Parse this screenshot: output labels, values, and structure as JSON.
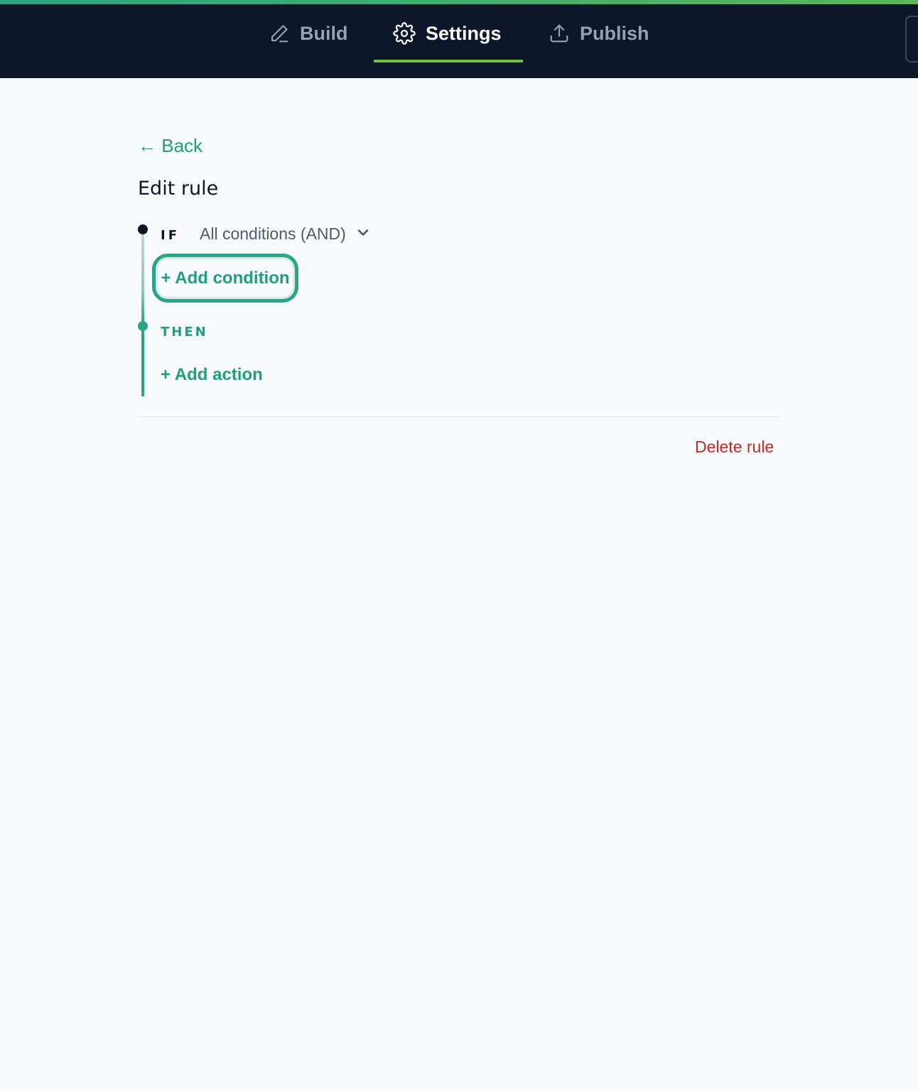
{
  "nav": {
    "tabs": [
      {
        "label": "Build",
        "icon": "pencil-icon",
        "active": false
      },
      {
        "label": "Settings",
        "icon": "gear-icon",
        "active": true
      },
      {
        "label": "Publish",
        "icon": "upload-icon",
        "active": false
      }
    ]
  },
  "page": {
    "back_label": "← Back",
    "title": "Edit rule"
  },
  "rule": {
    "if_label": "IF",
    "match_mode": "All conditions (AND)",
    "add_condition_label": "+ Add condition",
    "then_label": "THEN",
    "add_action_label": "+ Add action",
    "delete_label": "Delete rule"
  },
  "colors": {
    "header_bg": "#0c1829",
    "accent": "#2aa58a",
    "tab_underline": "#6cc24a",
    "danger": "#c62828",
    "page_bg": "#f8fafc"
  }
}
